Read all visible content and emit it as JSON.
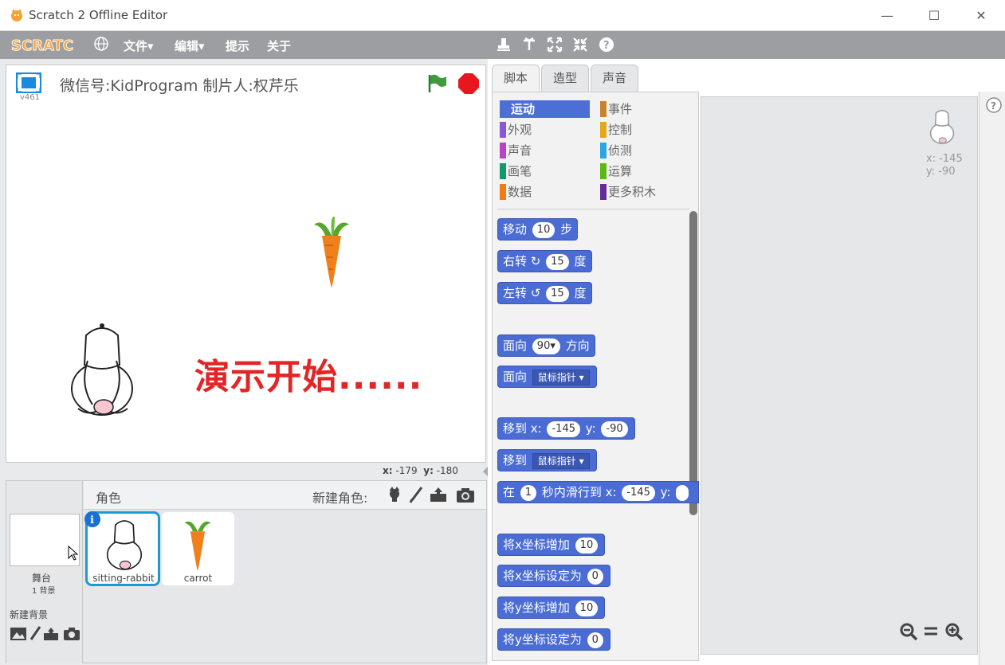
{
  "window": {
    "title": "Scratch 2 Offline Editor",
    "minimize": "—",
    "maximize": "☐",
    "close": "✕"
  },
  "menubar": {
    "logo_text": "SCRATCH",
    "items": [
      "文件▾",
      "编辑▾",
      "提示",
      "关于"
    ]
  },
  "stage": {
    "header_text": "微信号:KidProgram 制片人:权芹乐",
    "version": "v461",
    "demo_text": "演示开始......",
    "coords": {
      "x_label": "x:",
      "x_value": "-179",
      "y_label": "y:",
      "y_value": "-180"
    }
  },
  "sprites_panel": {
    "title": "角色",
    "new_sprite_label": "新建角色:",
    "stage_label": "舞台",
    "stage_backdrops": "1 背景",
    "new_backdrop_label": "新建背景",
    "sprites": [
      {
        "name": "sitting-rabbit",
        "selected": true
      },
      {
        "name": "carrot",
        "selected": false
      }
    ]
  },
  "tabs": [
    "脚本",
    "造型",
    "声音"
  ],
  "categories": [
    {
      "label": "运动",
      "color": "#4a6cd4",
      "active": true
    },
    {
      "label": "事件",
      "color": "#c88330"
    },
    {
      "label": "外观",
      "color": "#8a55d7"
    },
    {
      "label": "控制",
      "color": "#e1a91a"
    },
    {
      "label": "声音",
      "color": "#bb42c3"
    },
    {
      "label": "侦测",
      "color": "#2ca5e2"
    },
    {
      "label": "画笔",
      "color": "#0e9a6c"
    },
    {
      "label": "运算",
      "color": "#5cb712"
    },
    {
      "label": "数据",
      "color": "#ee7d16"
    },
    {
      "label": "更多积木",
      "color": "#632d99"
    }
  ],
  "blocks": {
    "move": {
      "pre": "移动",
      "v": "10",
      "post": "步"
    },
    "turn_right": {
      "pre": "右转",
      "v": "15",
      "post": "度"
    },
    "turn_left": {
      "pre": "左转",
      "v": "15",
      "post": "度"
    },
    "point_dir": {
      "pre": "面向",
      "v": "90▾",
      "post": "方向"
    },
    "point_towards": {
      "pre": "面向",
      "dd": "鼠标指针 ▾"
    },
    "goto_xy": {
      "pre": "移到 x:",
      "x": "-145",
      "ylbl": "y:",
      "y": "-90"
    },
    "goto": {
      "pre": "移到",
      "dd": "鼠标指针 ▾"
    },
    "glide": {
      "pre": "在",
      "secs": "1",
      "mid": "秒内滑行到 x:",
      "x": "-145",
      "ylbl": "y:"
    },
    "change_x": {
      "pre": "将x坐标增加",
      "v": "10"
    },
    "set_x": {
      "pre": "将x坐标设定为",
      "v": "0"
    },
    "change_y": {
      "pre": "将y坐标增加",
      "v": "10"
    },
    "set_y": {
      "pre": "将y坐标设定为",
      "v": "0"
    }
  },
  "script_area": {
    "sprite_x": "x: -145",
    "sprite_y": "y: -90"
  }
}
